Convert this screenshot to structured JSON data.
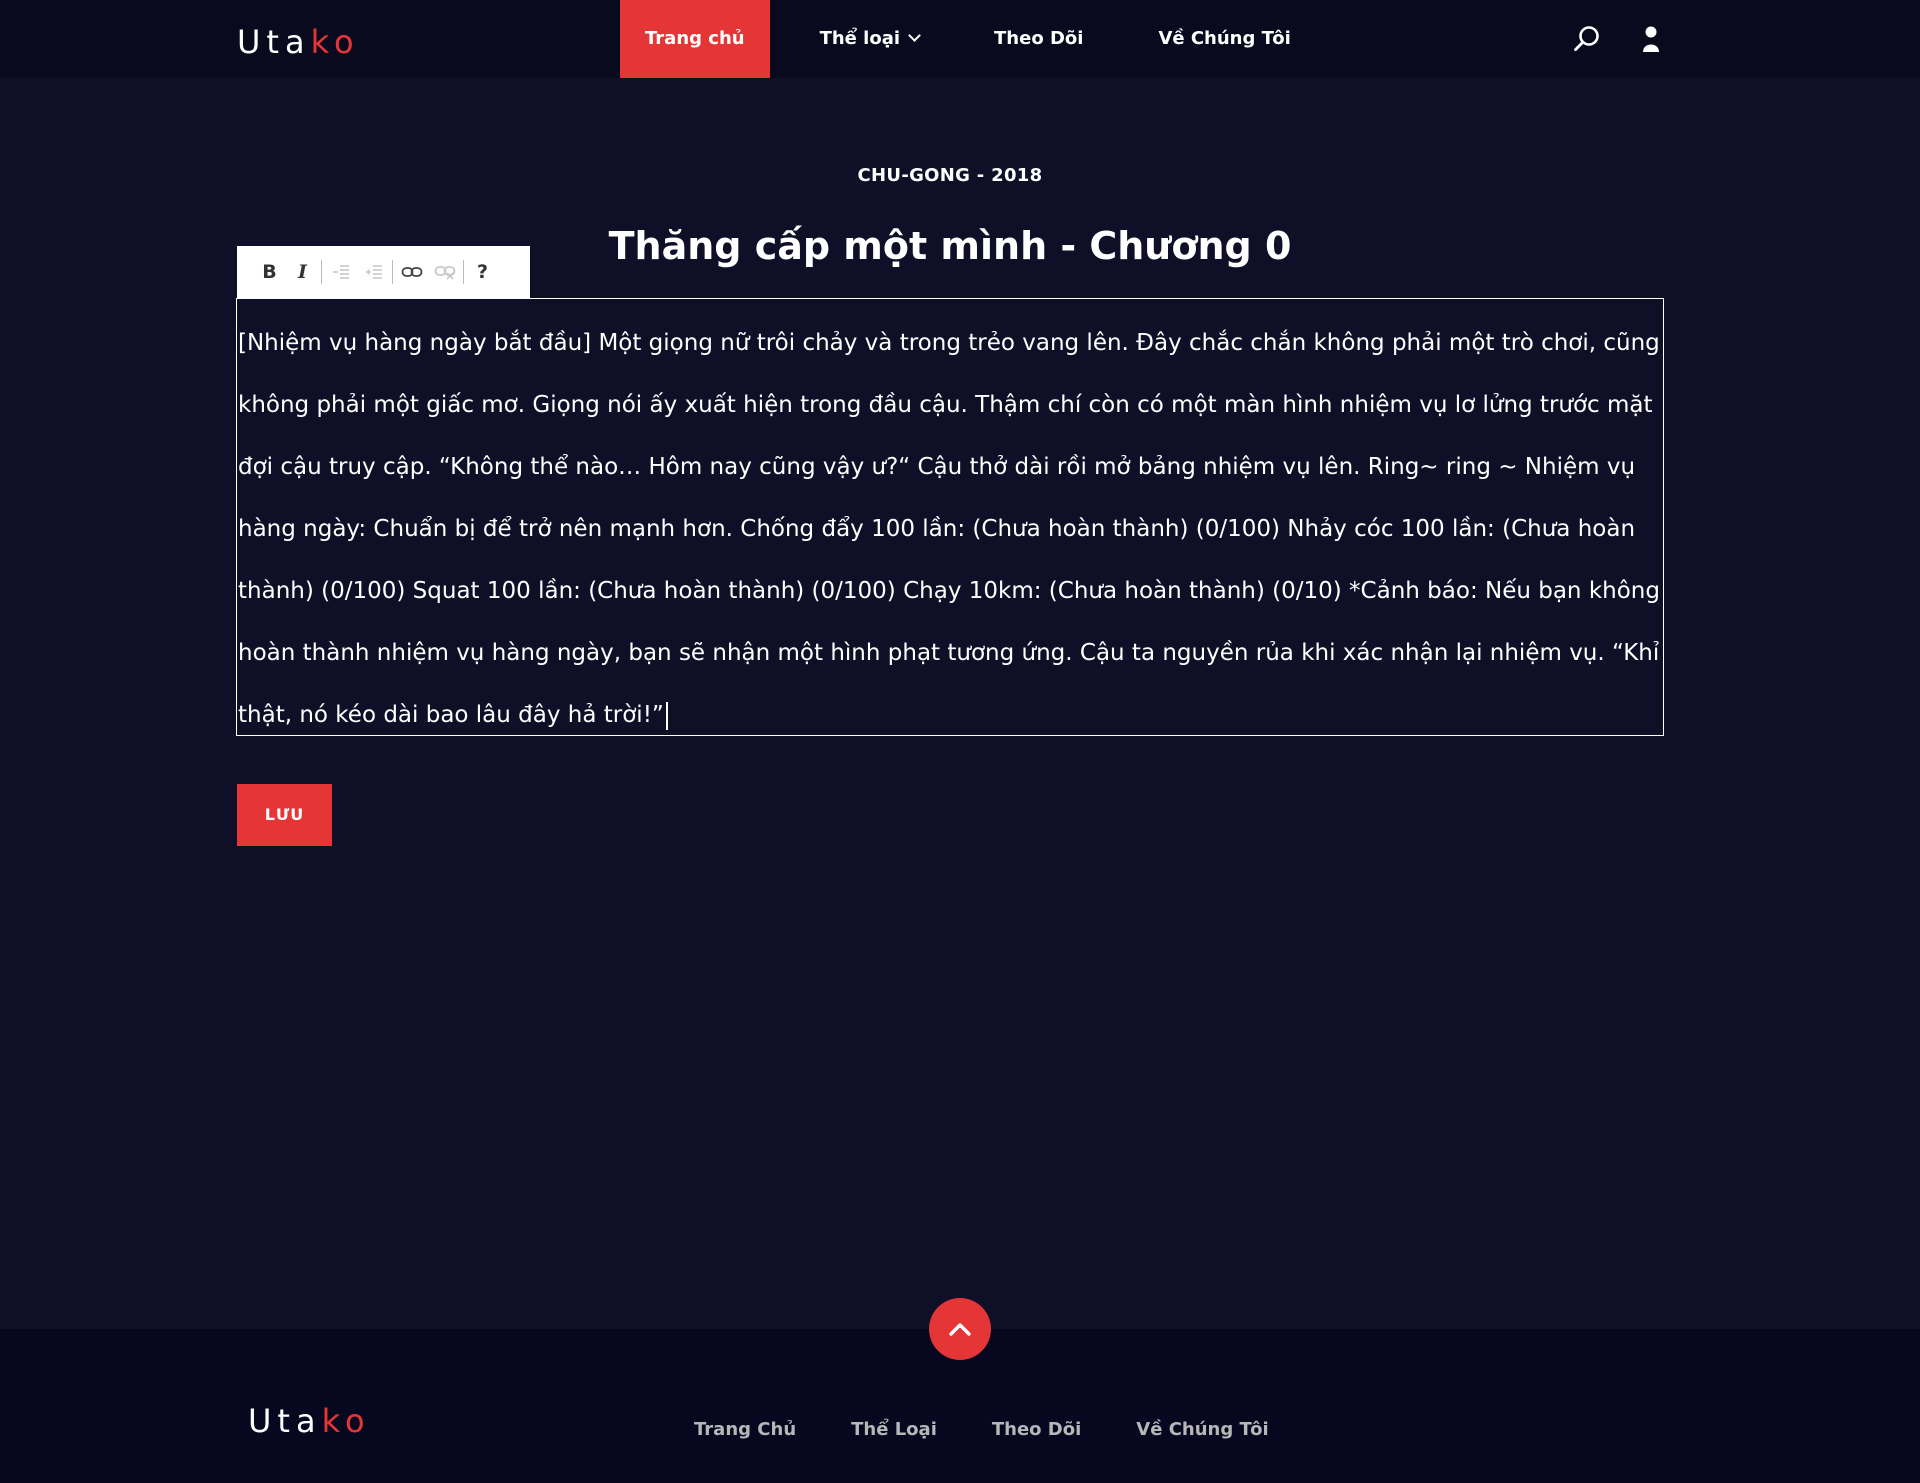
{
  "header": {
    "logo": {
      "part1": "Uta",
      "part2": "k",
      "part3": "o"
    },
    "nav": [
      {
        "label": "Trang chủ",
        "active": true
      },
      {
        "label": "Thể loại",
        "has_dropdown": true
      },
      {
        "label": "Theo Dõi"
      },
      {
        "label": "Về Chúng Tôi"
      }
    ],
    "icons": [
      "search-icon",
      "user-icon"
    ]
  },
  "chapter": {
    "meta": "CHU-GONG - 2018",
    "title": "Thăng cấp một mình - Chương 0"
  },
  "toolbar": {
    "buttons": [
      "bold",
      "italic",
      "outdent",
      "indent",
      "link",
      "unlink",
      "help"
    ],
    "bold_label": "B",
    "italic_label": "I",
    "help_label": "?"
  },
  "editor": {
    "content": "[Nhiệm vụ hàng ngày bắt đầu] Một giọng nữ trôi chảy và trong trẻo vang lên. Đây chắc chắn không phải một trò chơi, cũng không phải một giấc mơ. Giọng nói ấy xuất hiện trong đầu cậu. Thậm chí còn có một màn hình nhiệm vụ lơ lửng trước mặt đợi cậu truy cập. “Không thể nào… Hôm nay cũng vậy ư?“ Cậu thở dài rồi mở bảng nhiệm vụ lên. Ring~ ring ~ Nhiệm vụ hàng ngày: Chuẩn bị để trở nên mạnh hơn. Chống đẩy 100 lần: (Chưa hoàn thành) (0/100) Nhảy cóc 100 lần: (Chưa hoàn thành) (0/100) Squat 100 lần: (Chưa hoàn thành) (0/100) Chạy 10km: (Chưa hoàn thành) (0/10) *Cảnh báo: Nếu bạn không hoàn thành nhiệm vụ hàng ngày, bạn sẽ nhận một hình phạt tương ứng. Cậu ta nguyền rủa khi xác nhận lại nhiệm vụ. “Khỉ thật, nó kéo dài bao lâu đây hả trời!”"
  },
  "save_button": {
    "label": "LƯU"
  },
  "footer": {
    "logo": {
      "part1": "Uta",
      "part2": "k",
      "part3": "o"
    },
    "links": [
      "Trang Chủ",
      "Thể Loại",
      "Theo Dõi",
      "Về Chúng Tôi"
    ]
  },
  "colors": {
    "accent": "#e53637",
    "background": "#0f0f28",
    "header_bg": "#0a0a1f",
    "footer_bg": "#070720"
  }
}
